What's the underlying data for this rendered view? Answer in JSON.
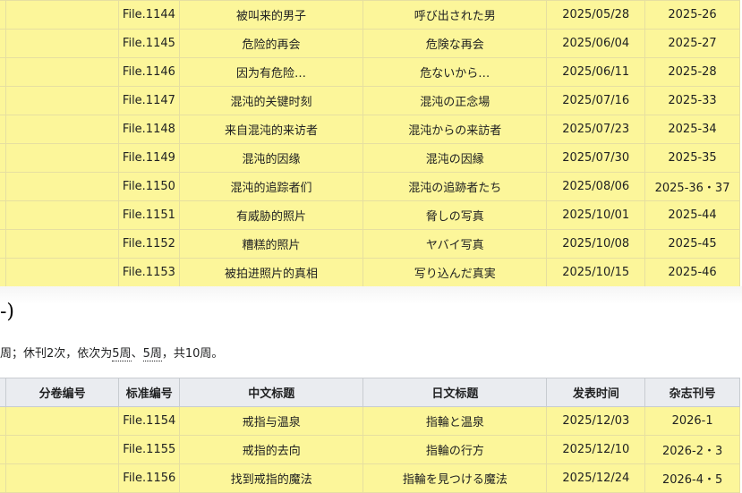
{
  "top_rows": [
    {
      "volume": "",
      "file": "File.1144",
      "cn": "被叫来的男子",
      "jp": "呼び出された男",
      "date": "2025/05/28",
      "issue": "2025-26"
    },
    {
      "volume": "",
      "file": "File.1145",
      "cn": "危险的再会",
      "jp": "危険な再会",
      "date": "2025/06/04",
      "issue": "2025-27"
    },
    {
      "volume": "",
      "file": "File.1146",
      "cn": "因为有危险…",
      "jp": "危ないから…",
      "date": "2025/06/11",
      "issue": "2025-28"
    },
    {
      "volume": "",
      "file": "File.1147",
      "cn": "混沌的关键时刻",
      "jp": "混沌の正念場",
      "date": "2025/07/16",
      "issue": "2025-33"
    },
    {
      "volume": "",
      "file": "File.1148",
      "cn": "来自混沌的来访者",
      "jp": "混沌からの来訪者",
      "date": "2025/07/23",
      "issue": "2025-34"
    },
    {
      "volume": "",
      "file": "File.1149",
      "cn": "混沌的因缘",
      "jp": "混沌の因縁",
      "date": "2025/07/30",
      "issue": "2025-35"
    },
    {
      "volume": "",
      "file": "File.1150",
      "cn": "混沌的追踪者们",
      "jp": "混沌の追跡者たち",
      "date": "2025/08/06",
      "issue": "2025-36・37"
    },
    {
      "volume": "",
      "file": "File.1151",
      "cn": "有威胁的照片",
      "jp": "脅しの写真",
      "date": "2025/10/01",
      "issue": "2025-44"
    },
    {
      "volume": "",
      "file": "File.1152",
      "cn": "糟糕的照片",
      "jp": "ヤバイ写真",
      "date": "2025/10/08",
      "issue": "2025-45"
    },
    {
      "volume": "",
      "file": "File.1153",
      "cn": "被拍进照片的真相",
      "jp": "写り込んだ真実",
      "date": "2025/10/15",
      "issue": "2025-46"
    }
  ],
  "section_heading": "-)",
  "note": {
    "before": "周；休刊2次，依次为",
    "link1": "5周",
    "sep": "、",
    "link2": "5周",
    "after": "，共10周。"
  },
  "headers": {
    "volume": "分卷编号",
    "file": "标准编号",
    "cn": "中文标题",
    "jp": "日文标题",
    "date": "发表时间",
    "issue": "杂志刊号"
  },
  "bottom_rows": [
    {
      "volume": "",
      "file": "File.1154",
      "cn": "戒指与温泉",
      "jp": "指輪と温泉",
      "date": "2025/12/03",
      "issue": "2026-1"
    },
    {
      "volume": "",
      "file": "File.1155",
      "cn": "戒指的去向",
      "jp": "指輪の行方",
      "date": "2025/12/10",
      "issue": "2026-2・3"
    },
    {
      "volume": "",
      "file": "File.1156",
      "cn": "找到戒指的魔法",
      "jp": "指輪を見つける魔法",
      "date": "2025/12/24",
      "issue": "2026-4・5"
    }
  ]
}
